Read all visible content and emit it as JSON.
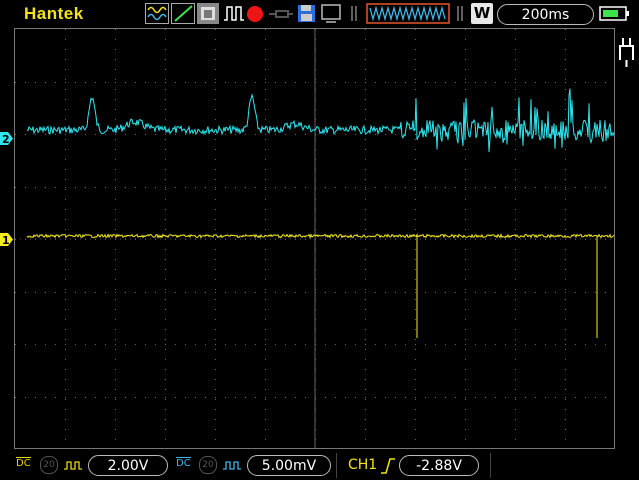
{
  "brand": "Hantek",
  "timebase": "200ms",
  "acquire_mode": "W",
  "colors": {
    "ch1": "#f6ec1d",
    "ch2": "#2ee6ee",
    "grid": "#555555",
    "accent": "#e8562d"
  },
  "channels": [
    {
      "marker": "1",
      "coupling": "DC",
      "bw_limit": "20",
      "scale": "2.00V"
    },
    {
      "marker": "2",
      "coupling": "DC",
      "bw_limit": "20",
      "scale": "5.00mV"
    }
  ],
  "trigger": {
    "source": "CH1",
    "edge": "rising",
    "level": "-2.88V"
  },
  "icons": [
    "wave-mode-icon",
    "ramp-icon",
    "persistence-icon",
    "pulse-icon",
    "record-icon",
    "probe-icon",
    "save-icon",
    "display-icon",
    "power-plug-icon",
    "battery-icon"
  ]
}
